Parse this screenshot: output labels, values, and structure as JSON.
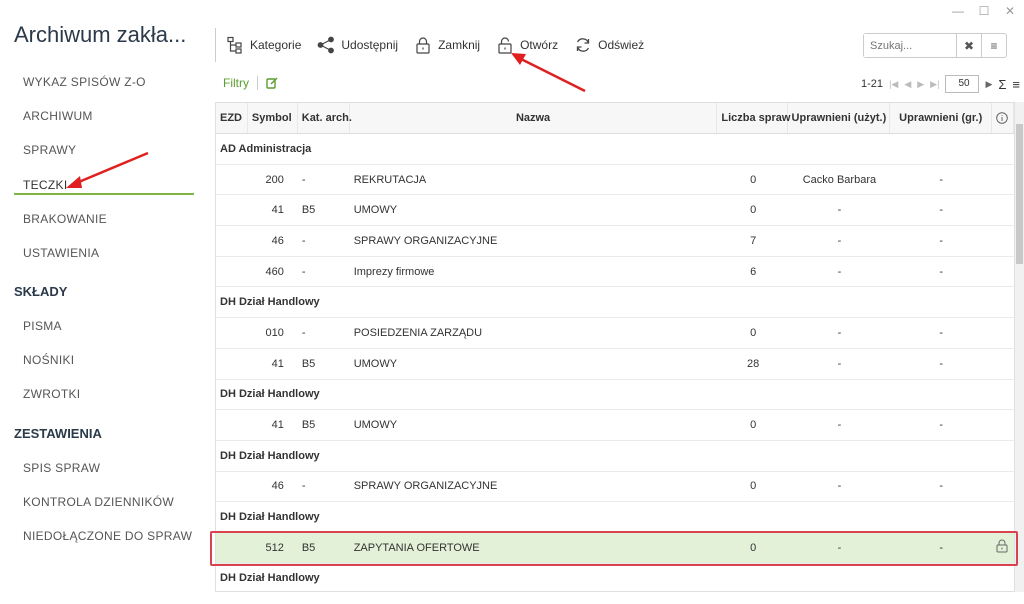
{
  "app": {
    "title": "Archiwum zakła..."
  },
  "window": {
    "min": "—",
    "max": "☐",
    "close": "✕"
  },
  "sidebar": {
    "items": [
      {
        "label": "WYKAZ SPISÓW Z-O"
      },
      {
        "label": "ARCHIWUM"
      },
      {
        "label": "SPRAWY"
      },
      {
        "label": "TECZKI",
        "active": true
      },
      {
        "label": "BRAKOWANIE"
      },
      {
        "label": "USTAWIENIA"
      }
    ],
    "sections": [
      {
        "title": "SKŁADY",
        "items": [
          "PISMA",
          "NOŚNIKI",
          "ZWROTKI"
        ]
      },
      {
        "title": "ZESTAWIENIA",
        "items": [
          "SPIS SPRAW",
          "KONTROLA DZIENNIKÓW",
          "NIEDOŁĄCZONE DO SPRAW"
        ]
      }
    ]
  },
  "toolbar": {
    "kategorie": "Kategorie",
    "udostepnij": "Udostępnij",
    "zamknij": "Zamknij",
    "otworz": "Otwórz",
    "odswiez": "Odśwież"
  },
  "search": {
    "placeholder": "Szukaj..."
  },
  "filters": {
    "label": "Filtry"
  },
  "pager": {
    "range": "1-21",
    "page_size": "50"
  },
  "table": {
    "columns": [
      "EZD",
      "Symbol",
      "Kat. arch.",
      "Nazwa",
      "Liczba spraw",
      "Uprawnieni (użyt.)",
      "Uprawnieni (gr.)"
    ],
    "rows": [
      {
        "group": "AD Administracja"
      },
      {
        "symbol": "200",
        "kat": "-",
        "nazwa": "REKRUTACJA",
        "liczba": "0",
        "upu": "Cacko Barbara",
        "upg": "-"
      },
      {
        "symbol": "41",
        "kat": "B5",
        "nazwa": "UMOWY",
        "liczba": "0",
        "upu": "-",
        "upg": "-"
      },
      {
        "symbol": "46",
        "kat": "-",
        "nazwa": "SPRAWY ORGANIZACYJNE",
        "liczba": "7",
        "upu": "-",
        "upg": "-"
      },
      {
        "symbol": "460",
        "kat": "-",
        "nazwa": "Imprezy firmowe",
        "liczba": "6",
        "upu": "-",
        "upg": "-"
      },
      {
        "group": "DH Dział Handlowy"
      },
      {
        "symbol": "010",
        "kat": "-",
        "nazwa": "POSIEDZENIA ZARZĄDU",
        "liczba": "0",
        "upu": "-",
        "upg": "-"
      },
      {
        "symbol": "41",
        "kat": "B5",
        "nazwa": "UMOWY",
        "liczba": "28",
        "upu": "-",
        "upg": "-"
      },
      {
        "group": "DH Dział Handlowy"
      },
      {
        "symbol": "41",
        "kat": "B5",
        "nazwa": "UMOWY",
        "liczba": "0",
        "upu": "-",
        "upg": "-"
      },
      {
        "group": "DH Dział Handlowy"
      },
      {
        "symbol": "46",
        "kat": "-",
        "nazwa": "SPRAWY ORGANIZACYJNE",
        "liczba": "0",
        "upu": "-",
        "upg": "-"
      },
      {
        "group": "DH Dział Handlowy"
      },
      {
        "symbol": "512",
        "kat": "B5",
        "nazwa": "ZAPYTANIA OFERTOWE",
        "liczba": "0",
        "upu": "-",
        "upg": "-",
        "highlight": true,
        "locked": true
      },
      {
        "group": "DH Dział Handlowy"
      }
    ]
  },
  "colors": {
    "accent": "#7cb342",
    "highlight_row": "#e2f1d7",
    "annotation": "#d9434e"
  }
}
